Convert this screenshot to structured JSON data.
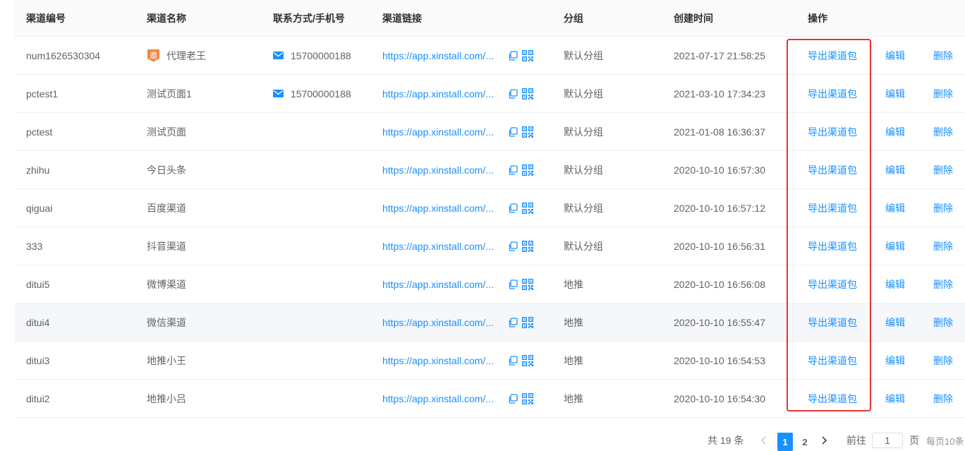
{
  "headers": {
    "code": "渠道编号",
    "name": "渠道名称",
    "contact": "联系方式/手机号",
    "link": "渠道链接",
    "group": "分组",
    "created": "创建时间",
    "ops": "操作"
  },
  "badge_char": "邀",
  "rows": [
    {
      "code": "num1626530304",
      "name": "代理老王",
      "phone": "15700000188",
      "url": "https://app.xinstall.com/...",
      "group": "默认分组",
      "created": "2021-07-17 21:58:25"
    },
    {
      "code": "pctest1",
      "name": "测试页面1",
      "phone": "15700000188",
      "url": "https://app.xinstall.com/...",
      "group": "默认分组",
      "created": "2021-03-10 17:34:23"
    },
    {
      "code": "pctest",
      "name": "测试页面",
      "phone": "",
      "url": "https://app.xinstall.com/...",
      "group": "默认分组",
      "created": "2021-01-08 16:36:37"
    },
    {
      "code": "zhihu",
      "name": "今日头条",
      "phone": "",
      "url": "https://app.xinstall.com/...",
      "group": "默认分组",
      "created": "2020-10-10 16:57:30"
    },
    {
      "code": "qiguai",
      "name": "百度渠道",
      "phone": "",
      "url": "https://app.xinstall.com/...",
      "group": "默认分组",
      "created": "2020-10-10 16:57:12"
    },
    {
      "code": "333",
      "name": "抖音渠道",
      "phone": "",
      "url": "https://app.xinstall.com/...",
      "group": "默认分组",
      "created": "2020-10-10 16:56:31"
    },
    {
      "code": "ditui5",
      "name": "微博渠道",
      "phone": "",
      "url": "https://app.xinstall.com/...",
      "group": "地推",
      "created": "2020-10-10 16:56:08"
    },
    {
      "code": "ditui4",
      "name": "微信渠道",
      "phone": "",
      "url": "https://app.xinstall.com/...",
      "group": "地推",
      "created": "2020-10-10 16:55:47"
    },
    {
      "code": "ditui3",
      "name": "地推小王",
      "phone": "",
      "url": "https://app.xinstall.com/...",
      "group": "地推",
      "created": "2020-10-10 16:54:53"
    },
    {
      "code": "ditui2",
      "name": "地推小吕",
      "phone": "",
      "url": "https://app.xinstall.com/...",
      "group": "地推",
      "created": "2020-10-10 16:54:30"
    }
  ],
  "ops": {
    "export": "导出渠道包",
    "edit": "编辑",
    "delete": "删除"
  },
  "pagination": {
    "total": "共 19 条",
    "pages": [
      "1",
      "2"
    ],
    "current": "1",
    "goto": "前往",
    "goto_value": "1",
    "page_suffix": "页",
    "page_size": "每页10条"
  },
  "colors": {
    "link": "#1890ff",
    "highlight_box": "#e53333",
    "badge": "#f0883e",
    "row_hover": "#f5f7fa"
  }
}
